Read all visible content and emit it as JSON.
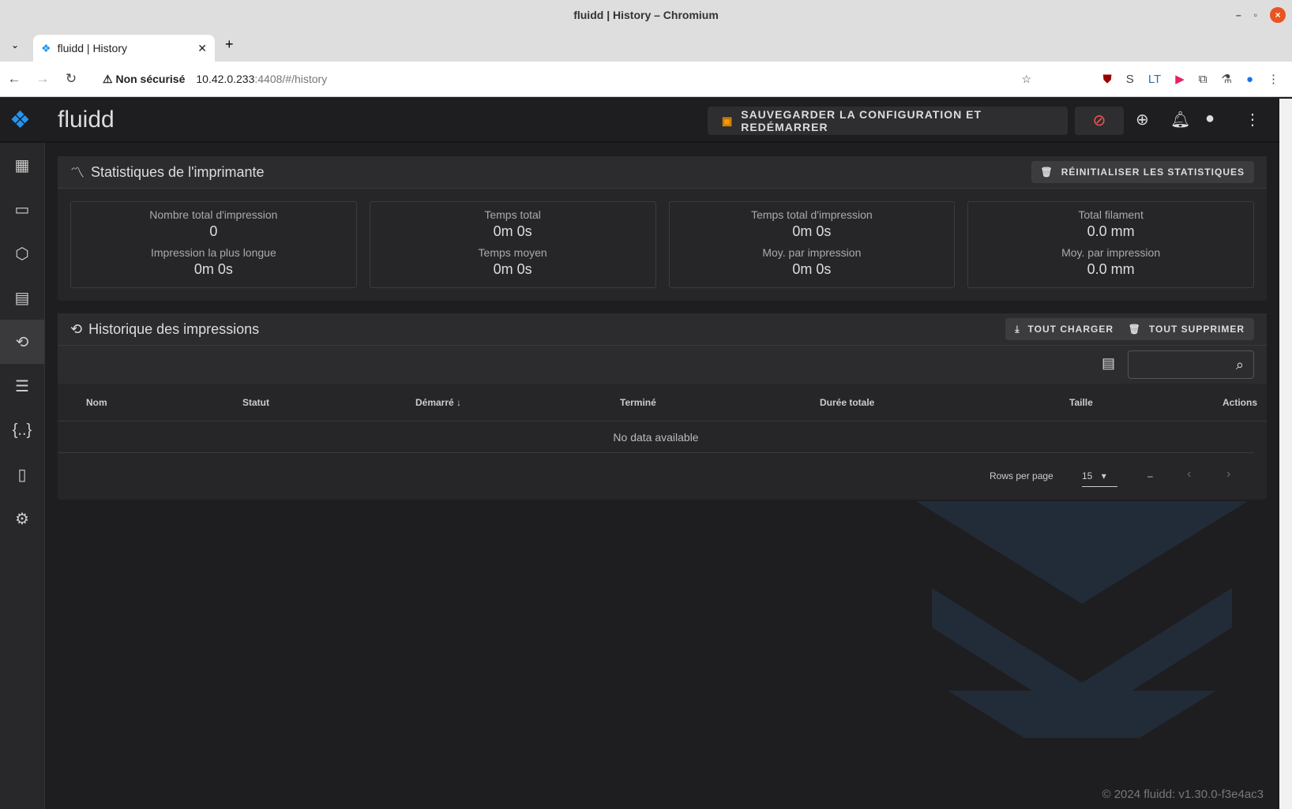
{
  "window": {
    "title": "fluidd | History – Chromium"
  },
  "browser": {
    "tab_title": "fluidd | History",
    "security": "Non sécurisé",
    "url_host": "10.42.0.233",
    "url_rest": ":4408/#/history"
  },
  "header": {
    "brand": "fluidd",
    "save_label": "SAUVEGARDER LA CONFIGURATION ET REDÉMARRER"
  },
  "stats": {
    "title": "Statistiques de l'imprimante",
    "reset_label": "RÉINITIALISER LES STATISTIQUES",
    "cards": [
      {
        "l1": "Nombre total d'impression",
        "v1": "0",
        "l2": "Impression la plus longue",
        "v2": "0m 0s"
      },
      {
        "l1": "Temps total",
        "v1": "0m 0s",
        "l2": "Temps moyen",
        "v2": "0m 0s"
      },
      {
        "l1": "Temps total d'impression",
        "v1": "0m 0s",
        "l2": "Moy. par impression",
        "v2": "0m 0s"
      },
      {
        "l1": "Total filament",
        "v1": "0.0 mm",
        "l2": "Moy. par impression",
        "v2": "0.0 mm"
      }
    ]
  },
  "history": {
    "title": "Historique des impressions",
    "load_all": "TOUT CHARGER",
    "delete_all": "TOUT SUPPRIMER",
    "columns": [
      "Nom",
      "Statut",
      "Démarré ↓",
      "Terminé",
      "Durée totale",
      "Taille",
      "Actions"
    ],
    "empty": "No data available",
    "rows_per_page_label": "Rows per page",
    "rows_per_page": "15",
    "range": "–"
  },
  "footer": {
    "copyright": "© 2024 fluidd: v1.30.0-f3e4ac3"
  }
}
